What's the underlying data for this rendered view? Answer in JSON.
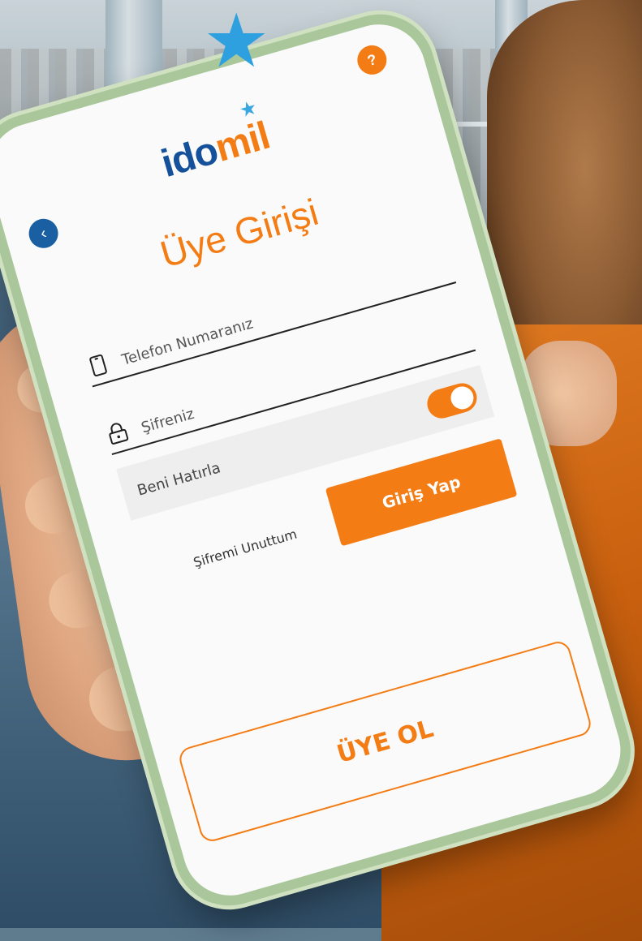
{
  "app": {
    "logo_part1": "ido",
    "logo_part2": "mil",
    "help_icon_text": "?",
    "back_icon": "chevron-left-icon",
    "title": "Üye Girişi"
  },
  "form": {
    "phone_placeholder": "Telefon Numaranız",
    "password_placeholder": "Şifreniz",
    "remember_label": "Beni Hatırla",
    "remember_checked": true,
    "login_label": "Giriş Yap",
    "forgot_label": "Şifremi Unuttum"
  },
  "footer": {
    "register_label": "ÜYE OL"
  },
  "colors": {
    "accent": "#f47c14",
    "brand_blue": "#15509a",
    "star_blue": "#2fa0df",
    "phone_frame": "#a9c79a"
  }
}
